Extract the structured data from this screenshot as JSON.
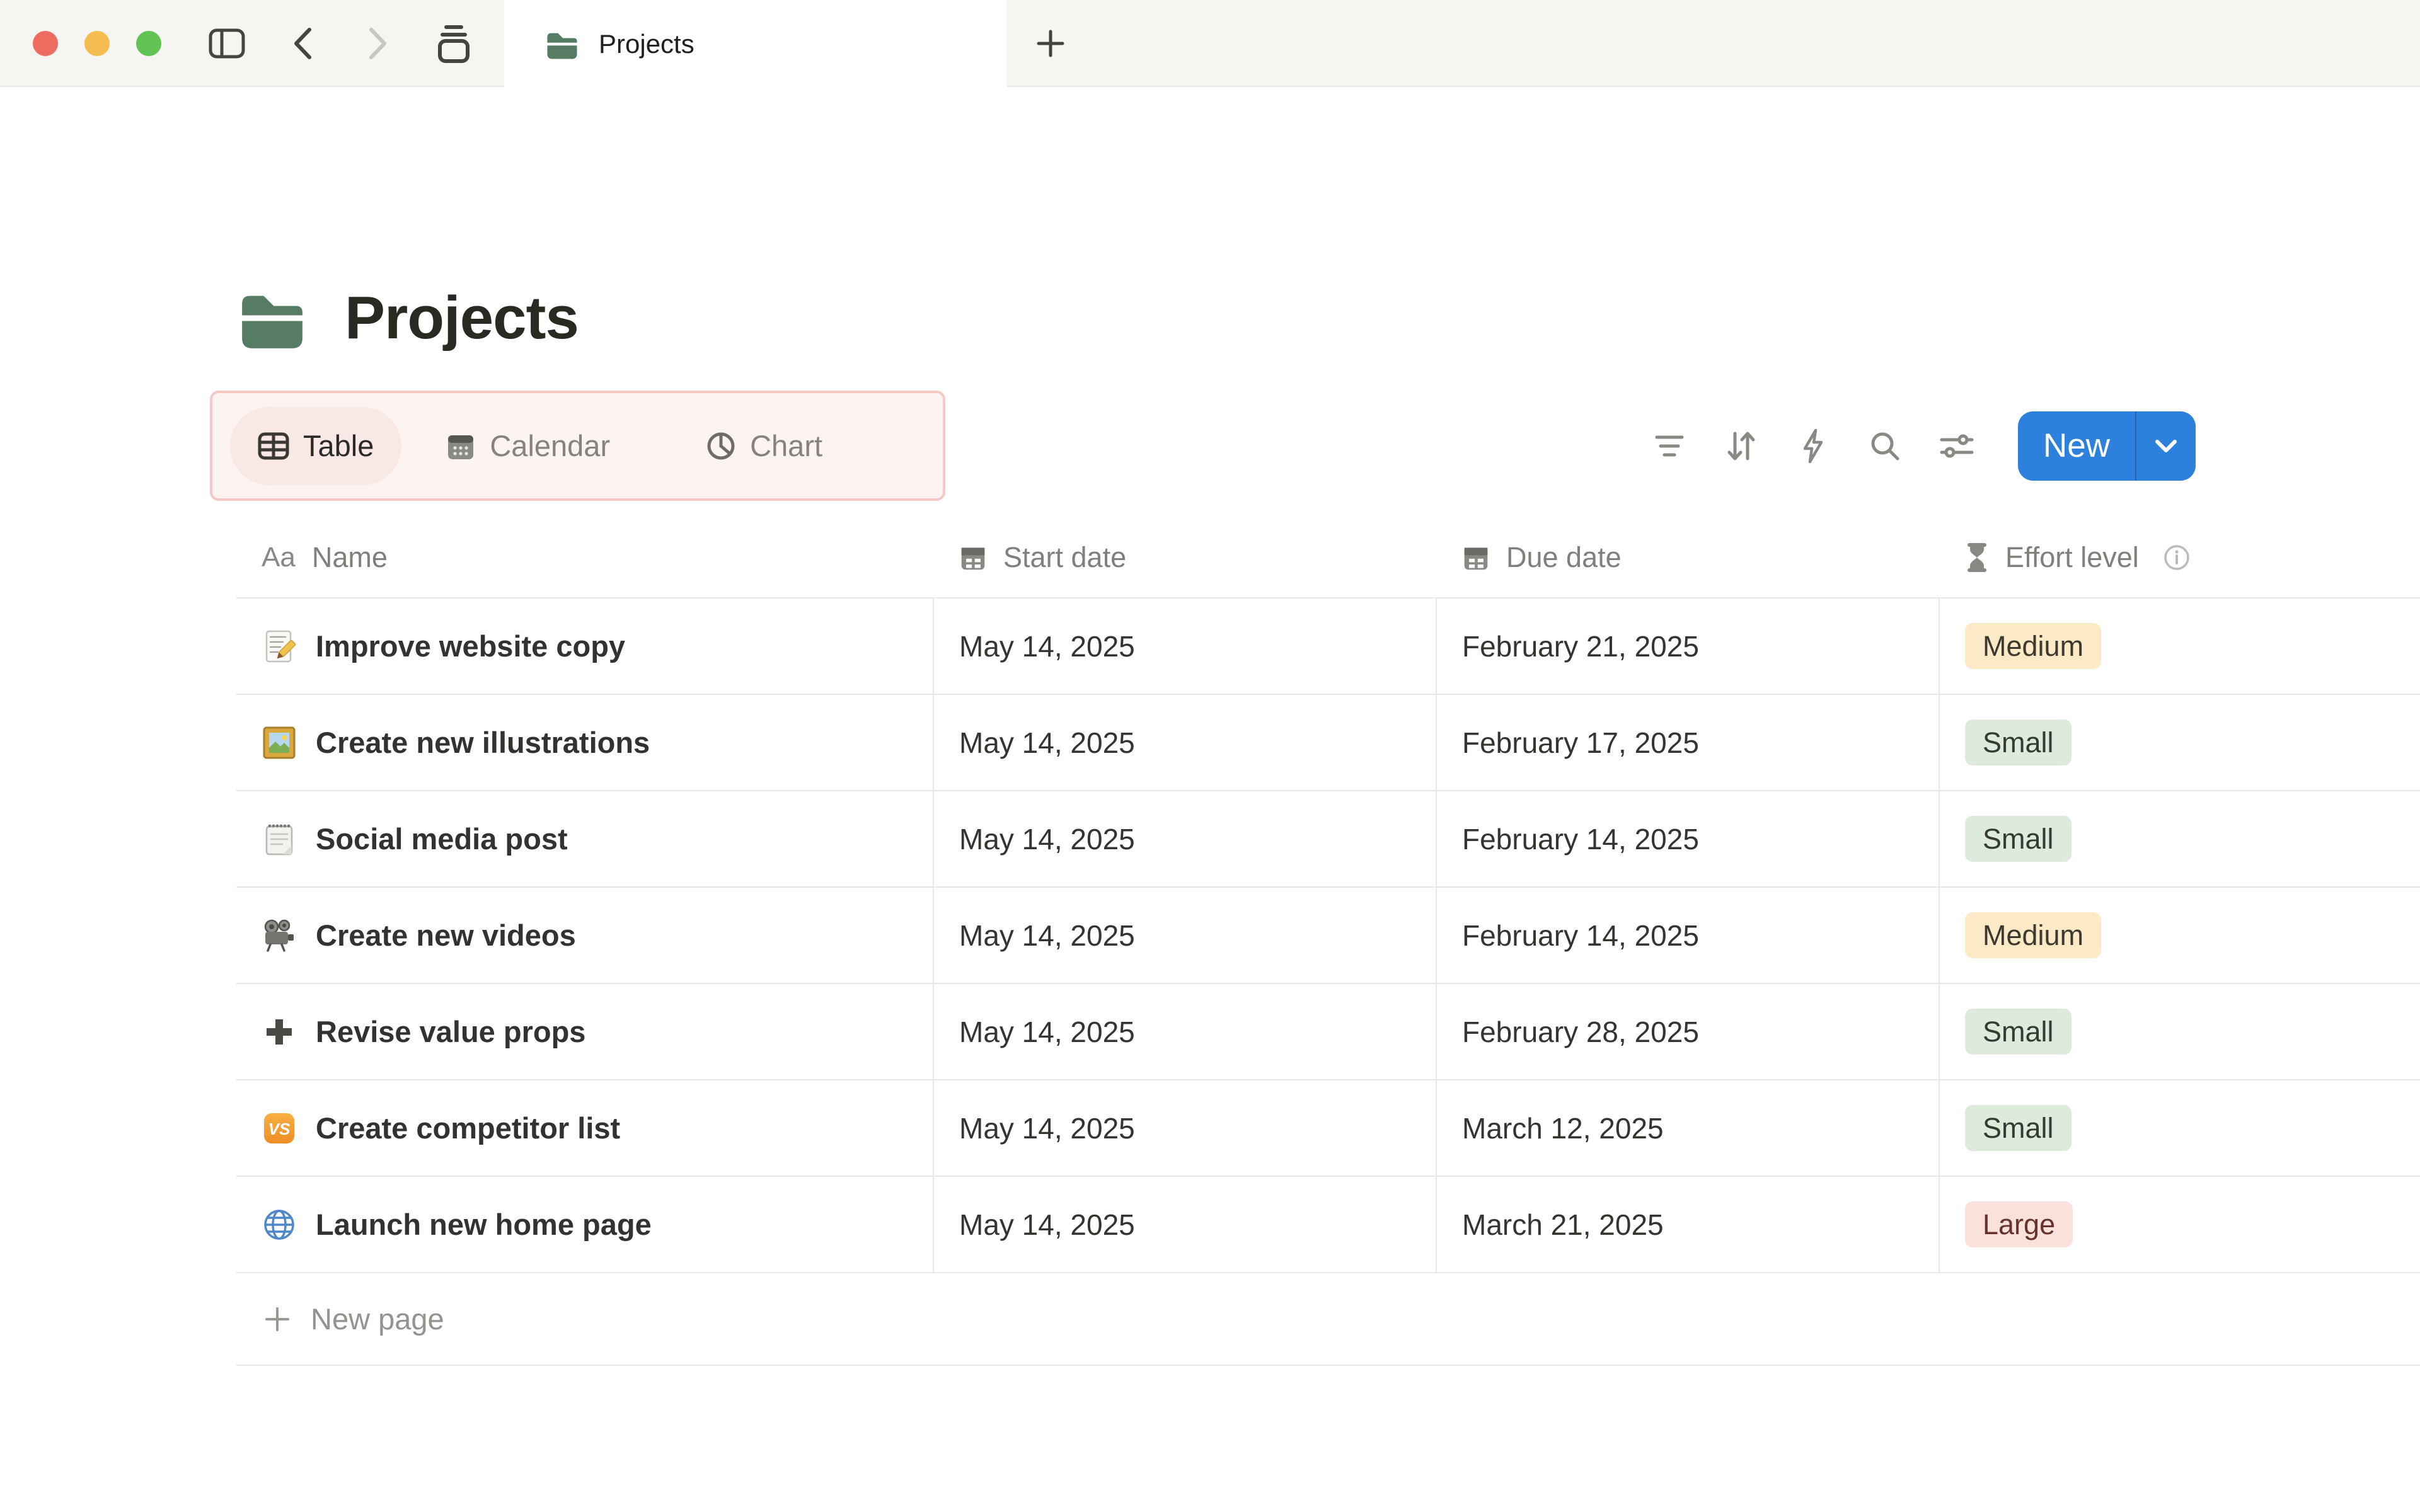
{
  "window": {
    "controls": {
      "close": "close-button",
      "minimize": "minimize-button",
      "zoom": "zoom-button",
      "close_color": "#ee6b60",
      "minimize_color": "#f5bd4f",
      "zoom_color": "#61c354"
    },
    "nav_icons": [
      "sidebar-toggle",
      "back",
      "forward",
      "tab-stack"
    ],
    "tab": {
      "title": "Projects",
      "icon": "folder-icon"
    },
    "new_tab_icon": "plus-icon"
  },
  "page": {
    "icon": "folder-icon",
    "icon_color": "#567d64",
    "title": "Projects"
  },
  "view_switcher": {
    "highlight_border": "#f6c8c3",
    "views": [
      {
        "label": "Table",
        "icon": "table-icon",
        "active": true
      },
      {
        "label": "Calendar",
        "icon": "calendar-icon",
        "active": false
      },
      {
        "label": "Chart",
        "icon": "pie-chart-icon",
        "active": false
      }
    ]
  },
  "toolbar": {
    "icons": [
      "filter-icon",
      "sort-icon",
      "automations-icon",
      "search-icon",
      "view-settings-icon"
    ],
    "new_button": {
      "label": "New",
      "color": "#2d80db",
      "chevron": "chevron-down-icon"
    }
  },
  "table": {
    "columns": [
      {
        "label": "Name",
        "icon": "text-aa-icon",
        "icon_text": "Aa"
      },
      {
        "label": "Start date",
        "icon": "calendar-icon"
      },
      {
        "label": "Due date",
        "icon": "calendar-icon"
      },
      {
        "label": "Effort level",
        "icon": "hourglass-icon",
        "info": "info-icon"
      }
    ],
    "rows": [
      {
        "icon": "memo-icon",
        "name": "Improve website copy",
        "start_date": "May 14, 2025",
        "due_date": "February 21, 2025",
        "effort_label": "Medium",
        "effort_color": "yellow"
      },
      {
        "icon": "framed-picture-icon",
        "name": "Create new illustrations",
        "start_date": "May 14, 2025",
        "due_date": "February 17, 2025",
        "effort_label": "Small",
        "effort_color": "green"
      },
      {
        "icon": "spiral-notepad-icon",
        "name": "Social media post",
        "start_date": "May 14, 2025",
        "due_date": "February 14, 2025",
        "effort_label": "Small",
        "effort_color": "green"
      },
      {
        "icon": "movie-camera-icon",
        "name": "Create new videos",
        "start_date": "May 14, 2025",
        "due_date": "February 14, 2025",
        "effort_label": "Medium",
        "effort_color": "yellow"
      },
      {
        "icon": "heavy-plus-icon",
        "name": "Revise value props",
        "start_date": "May 14, 2025",
        "due_date": "February 28, 2025",
        "effort_label": "Small",
        "effort_color": "green"
      },
      {
        "icon": "vs-icon",
        "name": "Create competitor list",
        "start_date": "May 14, 2025",
        "due_date": "March 12, 2025",
        "effort_label": "Small",
        "effort_color": "green"
      },
      {
        "icon": "globe-icon",
        "name": "Launch new home page",
        "start_date": "May 14, 2025",
        "due_date": "March 21, 2025",
        "effort_label": "Large",
        "effort_color": "red"
      }
    ],
    "new_page_label": "New page"
  },
  "colors": {
    "topbar_bg": "#f6f5f2",
    "page_bg": "#ffffff",
    "row_border": "#e9e8e6",
    "header_text": "#817f7a",
    "body_text": "#35342f",
    "badge_yellow_bg": "#fbeac5",
    "badge_green_bg": "#dcebdc",
    "badge_red_bg": "#fbe1dc",
    "accent_blue": "#2d80db",
    "folder_green": "#567d64"
  }
}
